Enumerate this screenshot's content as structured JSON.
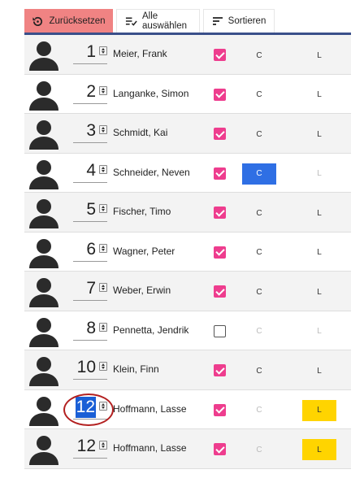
{
  "toolbar": {
    "reset_label": "Zurücksetzen",
    "select_all_label": "Alle auswählen",
    "sort_label": "Sortieren"
  },
  "colors": {
    "reset_bg": "#f08383",
    "check_on": "#ee3d8e",
    "c_active": "#2f6fe4",
    "l_active": "#ffd400",
    "accent_line": "#3a4f8a"
  },
  "rows": [
    {
      "number": "1",
      "name": "Meier, Frank",
      "checked": true,
      "c": "C",
      "c_state": "normal",
      "l": "L",
      "l_state": "normal",
      "number_selected": false,
      "highlighted": false
    },
    {
      "number": "2",
      "name": "Langanke, Simon",
      "checked": true,
      "c": "C",
      "c_state": "normal",
      "l": "L",
      "l_state": "normal",
      "number_selected": false,
      "highlighted": false
    },
    {
      "number": "3",
      "name": "Schmidt, Kai",
      "checked": true,
      "c": "C",
      "c_state": "normal",
      "l": "L",
      "l_state": "normal",
      "number_selected": false,
      "highlighted": false
    },
    {
      "number": "4",
      "name": "Schneider, Neven",
      "checked": true,
      "c": "C",
      "c_state": "active",
      "l": "L",
      "l_state": "dim",
      "number_selected": false,
      "highlighted": false
    },
    {
      "number": "5",
      "name": "Fischer, Timo",
      "checked": true,
      "c": "C",
      "c_state": "normal",
      "l": "L",
      "l_state": "normal",
      "number_selected": false,
      "highlighted": false
    },
    {
      "number": "6",
      "name": "Wagner, Peter",
      "checked": true,
      "c": "C",
      "c_state": "normal",
      "l": "L",
      "l_state": "normal",
      "number_selected": false,
      "highlighted": false
    },
    {
      "number": "7",
      "name": "Weber, Erwin",
      "checked": true,
      "c": "C",
      "c_state": "normal",
      "l": "L",
      "l_state": "normal",
      "number_selected": false,
      "highlighted": false
    },
    {
      "number": "8",
      "name": "Pennetta, Jendrik",
      "checked": false,
      "c": "C",
      "c_state": "dim",
      "l": "L",
      "l_state": "dim",
      "number_selected": false,
      "highlighted": false
    },
    {
      "number": "10",
      "name": "Klein, Finn",
      "checked": true,
      "c": "C",
      "c_state": "normal",
      "l": "L",
      "l_state": "normal",
      "number_selected": false,
      "highlighted": false
    },
    {
      "number": "12",
      "name": "Hoffmann, Lasse",
      "checked": true,
      "c": "C",
      "c_state": "dim",
      "l": "L",
      "l_state": "active",
      "number_selected": true,
      "highlighted": true
    },
    {
      "number": "12",
      "name": "Hoffmann, Lasse",
      "checked": true,
      "c": "C",
      "c_state": "dim",
      "l": "L",
      "l_state": "active",
      "number_selected": false,
      "highlighted": false
    }
  ]
}
